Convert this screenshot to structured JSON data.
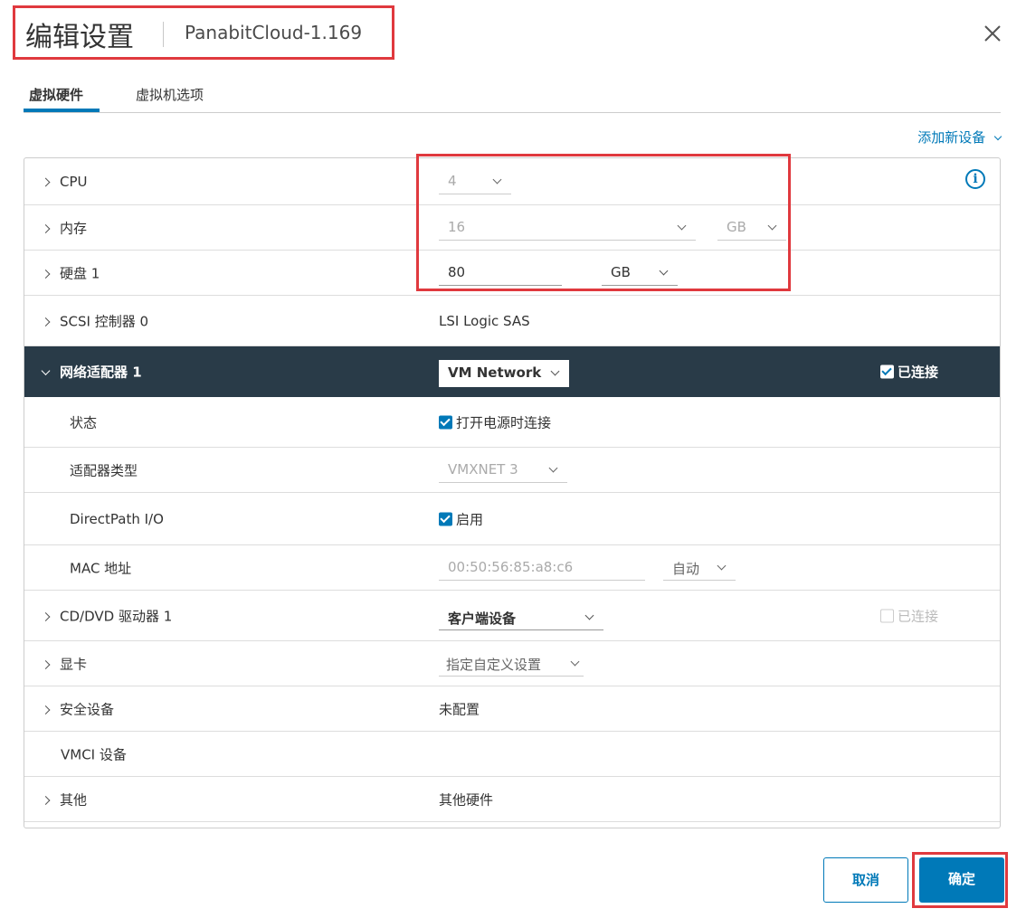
{
  "header": {
    "title": "编辑设置",
    "subtitle": "PanabitCloud-1.169"
  },
  "tabs": [
    "虚拟硬件",
    "虚拟机选项"
  ],
  "add_device_label": "添加新设备",
  "rows": {
    "cpu": {
      "label": "CPU",
      "value": "4"
    },
    "memory": {
      "label": "内存",
      "value": "16",
      "unit": "GB"
    },
    "disk": {
      "label": "硬盘 1",
      "value": "80",
      "unit": "GB"
    },
    "scsi": {
      "label": "SCSI 控制器 0",
      "value": "LSI Logic SAS"
    },
    "network": {
      "label": "网络适配器 1",
      "value": "VM Network",
      "connected_label": "已连接"
    },
    "status": {
      "label": "状态",
      "value": "打开电源时连接"
    },
    "adapter_type": {
      "label": "适配器类型",
      "value": "VMXNET 3"
    },
    "directpath": {
      "label": "DirectPath I/O",
      "value": "启用"
    },
    "mac": {
      "label": "MAC 地址",
      "value": "00:50:56:85:a8:c6",
      "mode": "自动"
    },
    "cd_dvd": {
      "label": "CD/DVD 驱动器 1",
      "value": "客户端设备",
      "connected_label": "已连接"
    },
    "video": {
      "label": "显卡",
      "value": "指定自定义设置"
    },
    "security": {
      "label": "安全设备",
      "value": "未配置"
    },
    "vmci": {
      "label": "VMCI 设备"
    },
    "other": {
      "label": "其他",
      "value": "其他硬件"
    }
  },
  "buttons": {
    "cancel": "取消",
    "ok": "确定"
  }
}
